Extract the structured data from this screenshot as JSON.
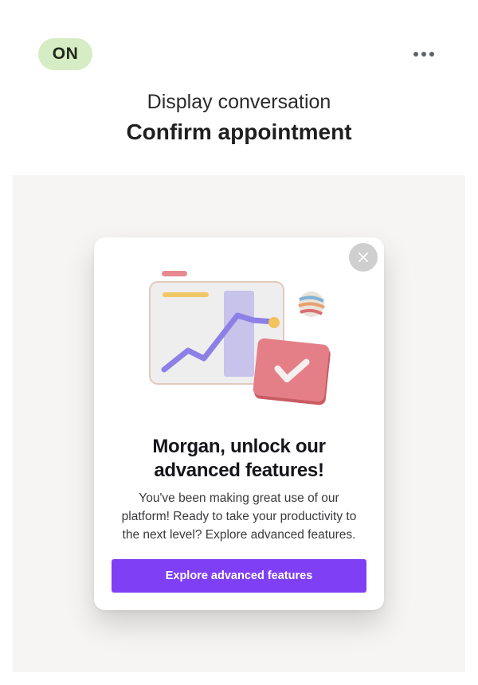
{
  "header": {
    "status_badge": "ON",
    "more_menu_icon": "more-horizontal-icon"
  },
  "intro": {
    "subtitle": "Display conversation",
    "title": "Confirm appointment"
  },
  "modal": {
    "close_icon": "close-icon",
    "illustration": "analytics-chart-checkmark-illustration",
    "heading_line1": "Morgan, unlock our",
    "heading_line2": "advanced features!",
    "body_line1": "You've been making great use of our",
    "body_line2": "platform! Ready to take your productivity to",
    "body_line3": "the next level? Explore advanced features.",
    "cta_label": "Explore advanced features"
  },
  "colors": {
    "status_badge_bg": "#d6ecc4",
    "preview_bg": "#f6f5f4",
    "cta_bg": "#7f3ff5",
    "close_bg": "#cfcfcf"
  }
}
